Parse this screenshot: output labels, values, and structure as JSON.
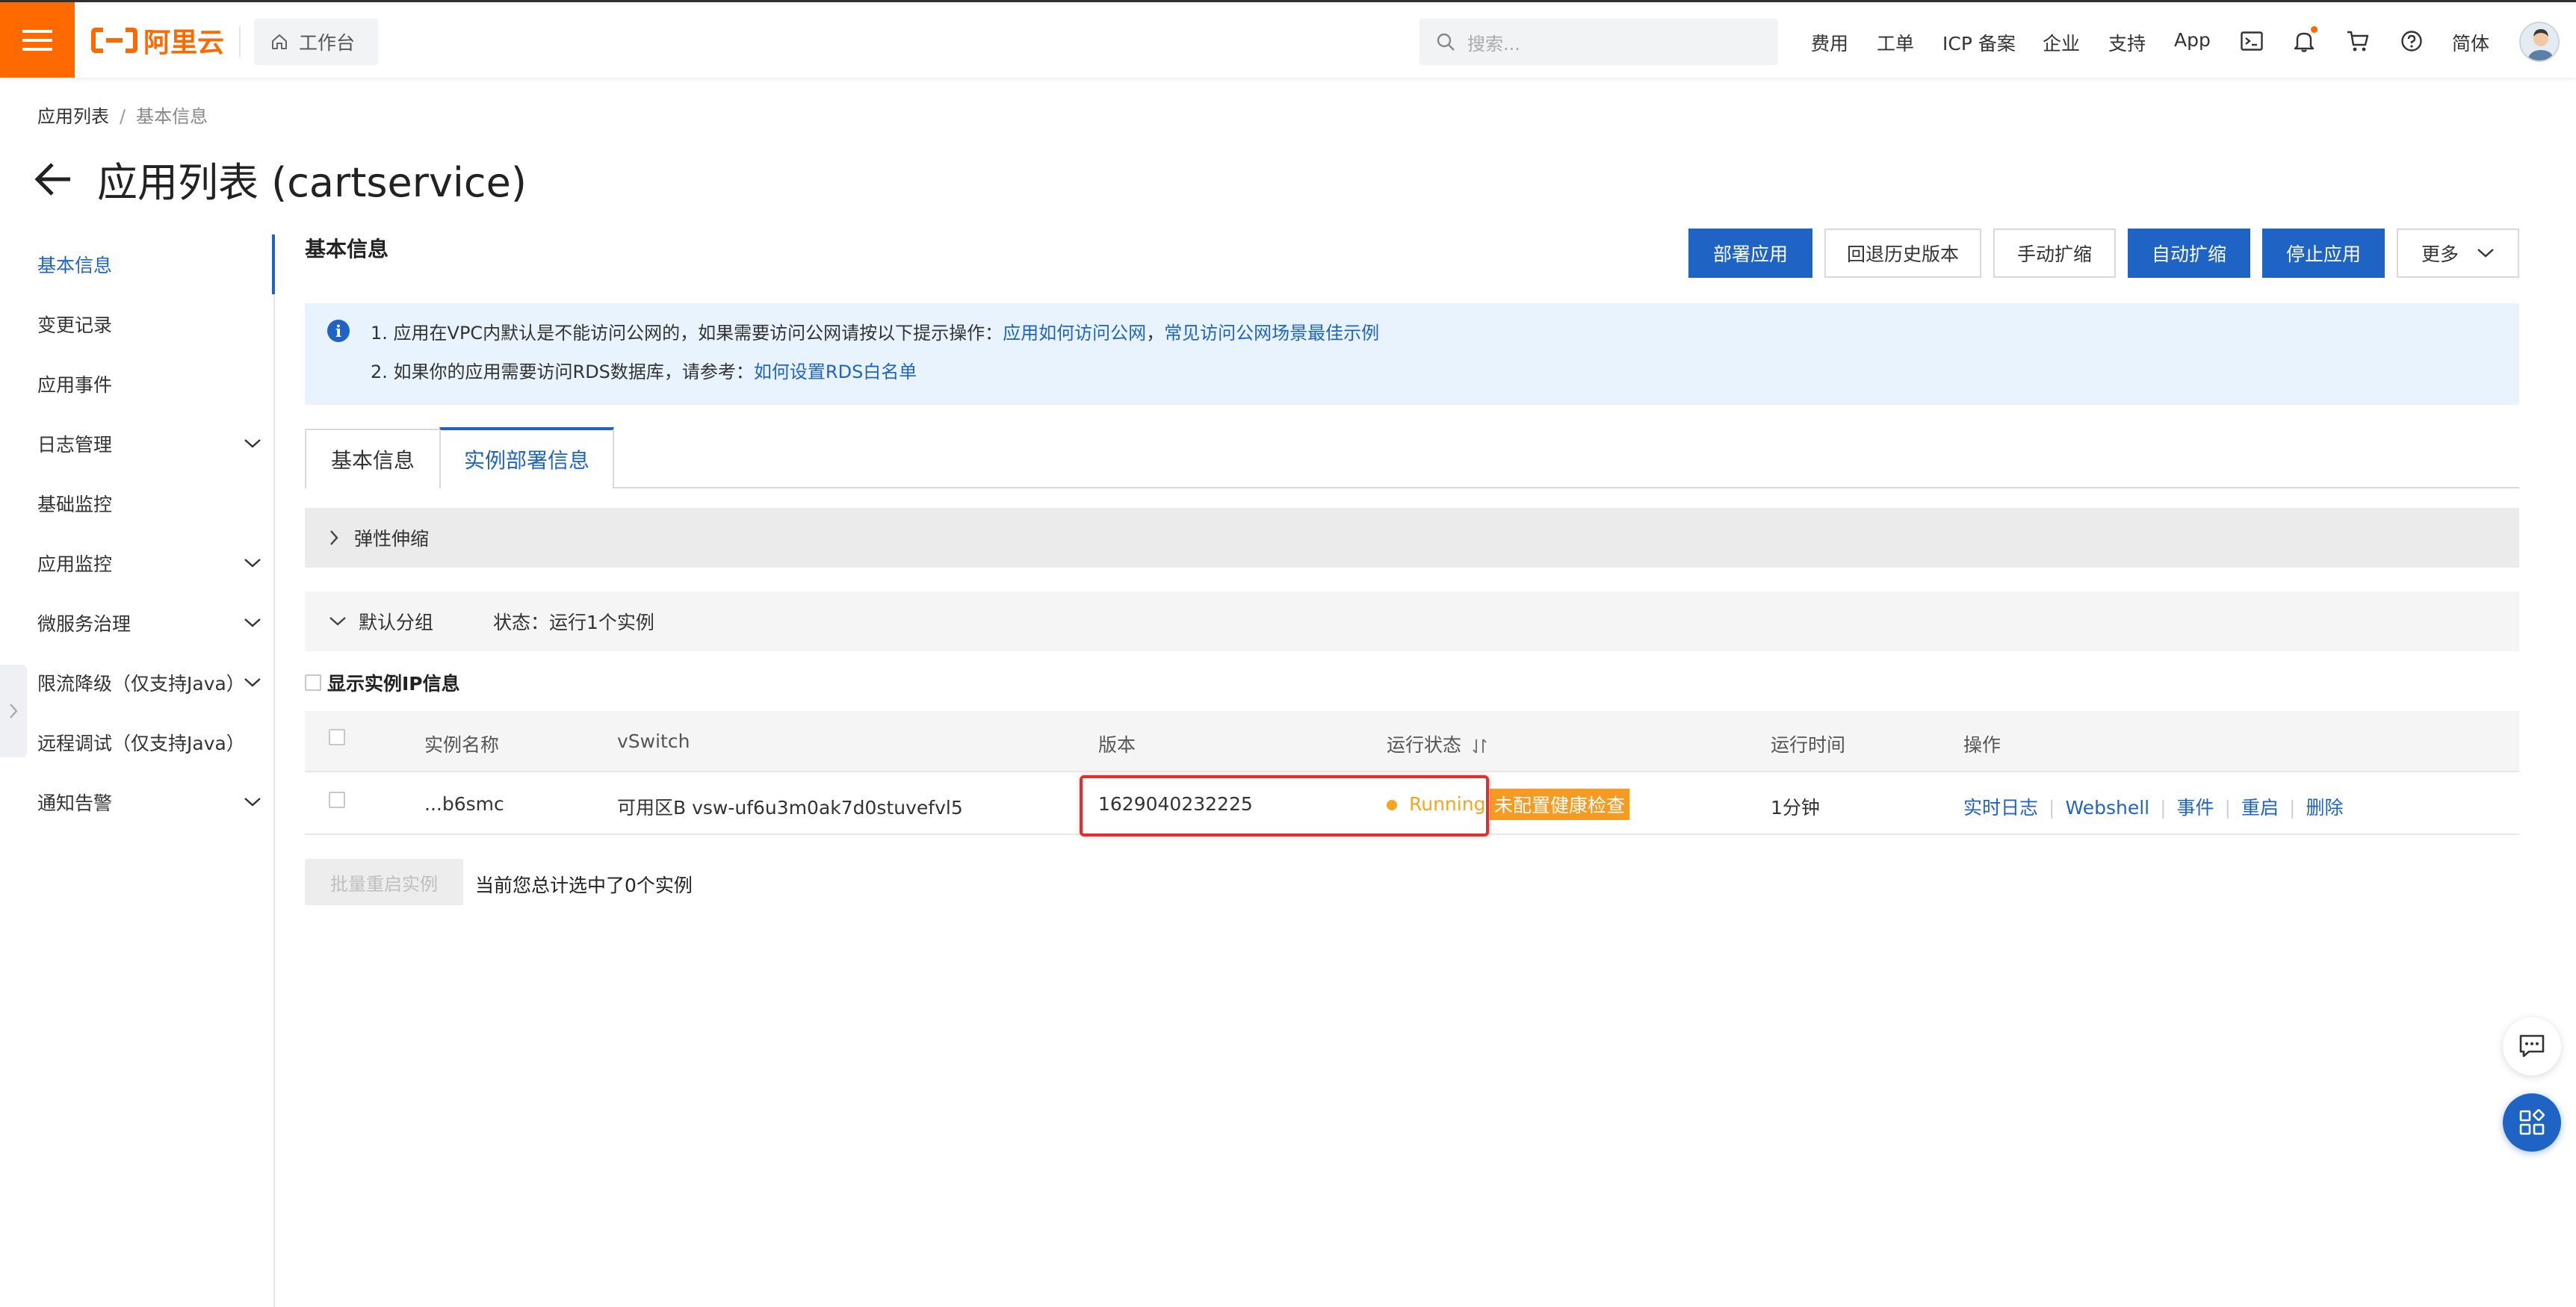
{
  "topbar": {
    "brand": "阿里云",
    "workbench": "工作台",
    "search_placeholder": "搜索...",
    "nav": [
      "费用",
      "工单",
      "ICP 备案",
      "企业",
      "支持",
      "App"
    ],
    "lang": "简体",
    "icons": [
      "terminal-icon",
      "bell-icon",
      "cart-icon",
      "help-icon"
    ],
    "accent_color": "#ff6a00"
  },
  "breadcrumb": {
    "root": "应用列表",
    "current": "基本信息"
  },
  "page": {
    "title": "应用列表 (cartservice)"
  },
  "sidebar": {
    "items": [
      {
        "label": "基本信息",
        "expandable": false,
        "active": true
      },
      {
        "label": "变更记录",
        "expandable": false
      },
      {
        "label": "应用事件",
        "expandable": false
      },
      {
        "label": "日志管理",
        "expandable": true
      },
      {
        "label": "基础监控",
        "expandable": false
      },
      {
        "label": "应用监控",
        "expandable": true
      },
      {
        "label": "微服务治理",
        "expandable": true
      },
      {
        "label": "限流降级（仅支持Java）",
        "expandable": true
      },
      {
        "label": "远程调试（仅支持Java）",
        "expandable": false
      },
      {
        "label": "通知告警",
        "expandable": true
      }
    ]
  },
  "main": {
    "section_title": "基本信息",
    "actions": {
      "deploy": "部署应用",
      "rollback": "回退历史版本",
      "manual_scale": "手动扩缩",
      "auto_scale": "自动扩缩",
      "stop": "停止应用",
      "more": "更多"
    },
    "notice": {
      "line1_prefix": "1. 应用在VPC内默认是不能访问公网的，如果需要访问公网请按以下提示操作：",
      "line1_link1": "应用如何访问公网",
      "line1_comma": "，",
      "line1_link2": "常见访问公网场景最佳示例",
      "line2_prefix": "2. 如果你的应用需要访问RDS数据库，请参考：",
      "line2_link": "如何设置RDS白名单"
    },
    "tabs": [
      "基本信息",
      "实例部署信息"
    ],
    "active_tab": 1,
    "elastic_section": "弹性伸缩",
    "group": {
      "name": "默认分组",
      "status": "状态：运行1个实例"
    },
    "show_ip_label": "显示实例IP信息",
    "table": {
      "headers": [
        "实例名称",
        "vSwitch",
        "版本",
        "运行状态",
        "运行时间",
        "操作"
      ],
      "rows": [
        {
          "name": "...b6smc",
          "vswitch": "可用区B vsw-uf6u3m0ak7d0stuvefvl5",
          "version": "1629040232225",
          "status": "Running",
          "health_badge": "未配置健康检查",
          "runtime": "1分钟",
          "ops": [
            "实时日志",
            "Webshell",
            "事件",
            "重启",
            "删除"
          ]
        }
      ]
    },
    "batch_restart": "批量重启实例",
    "selection_text": "当前您总计选中了0个实例"
  }
}
